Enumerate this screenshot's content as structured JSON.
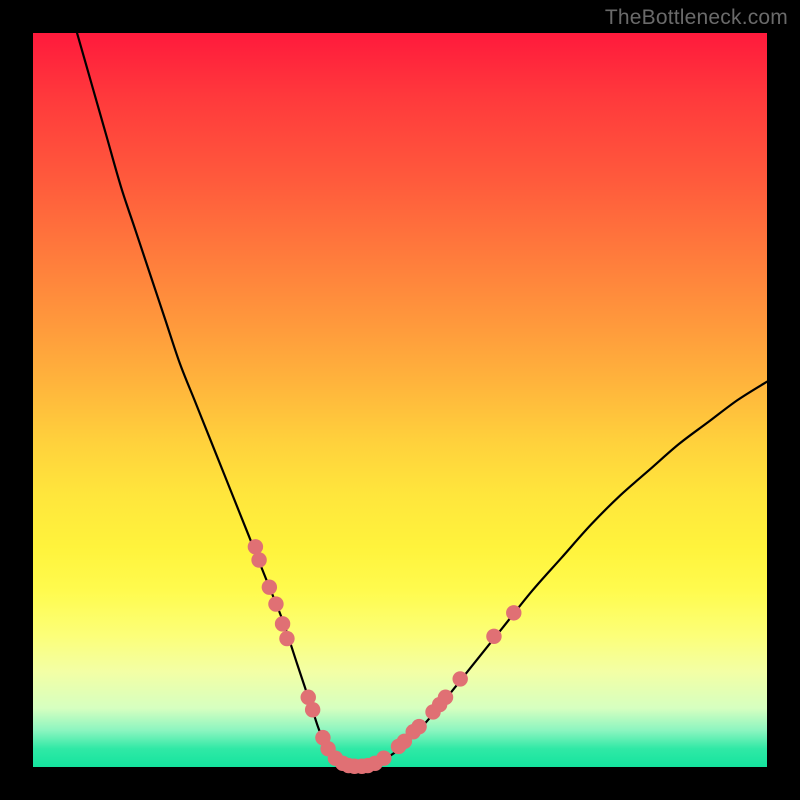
{
  "watermark": "TheBottleneck.com",
  "chart_data": {
    "type": "line",
    "title": "",
    "xlabel": "",
    "ylabel": "",
    "xlim": [
      0,
      100
    ],
    "ylim": [
      0,
      100
    ],
    "grid": false,
    "series": [
      {
        "name": "curve",
        "color": "#000000",
        "x": [
          6,
          8,
          10,
          12,
          14,
          16,
          18,
          20,
          22,
          24,
          26,
          28,
          30,
          32,
          34,
          36,
          37,
          38,
          39,
          40,
          41,
          42,
          43,
          45,
          47,
          50,
          53,
          56,
          60,
          64,
          68,
          72,
          76,
          80,
          84,
          88,
          92,
          96,
          100
        ],
        "y": [
          100,
          93,
          86,
          79,
          73,
          67,
          61,
          55,
          50,
          45,
          40,
          35,
          30,
          25,
          20,
          14,
          11,
          8,
          5,
          3,
          1.5,
          0.6,
          0,
          0,
          0.6,
          2.5,
          5.5,
          9,
          14,
          19,
          24,
          28.5,
          33,
          37,
          40.5,
          44,
          47,
          50,
          52.5
        ]
      }
    ],
    "markers": [
      {
        "x": 30.3,
        "y": 30,
        "r": 1.05
      },
      {
        "x": 30.8,
        "y": 28.2,
        "r": 1.05
      },
      {
        "x": 32.2,
        "y": 24.5,
        "r": 1.05
      },
      {
        "x": 33.1,
        "y": 22.2,
        "r": 1.05
      },
      {
        "x": 34.0,
        "y": 19.5,
        "r": 1.05
      },
      {
        "x": 34.6,
        "y": 17.5,
        "r": 1.05
      },
      {
        "x": 37.5,
        "y": 9.5,
        "r": 1.05
      },
      {
        "x": 38.1,
        "y": 7.8,
        "r": 1.05
      },
      {
        "x": 39.5,
        "y": 4.0,
        "r": 1.05
      },
      {
        "x": 40.2,
        "y": 2.5,
        "r": 1.05
      },
      {
        "x": 41.2,
        "y": 1.2,
        "r": 1.05
      },
      {
        "x": 42.2,
        "y": 0.5,
        "r": 1.05
      },
      {
        "x": 43.0,
        "y": 0.2,
        "r": 1.05
      },
      {
        "x": 43.8,
        "y": 0.1,
        "r": 1.05
      },
      {
        "x": 44.8,
        "y": 0.1,
        "r": 1.05
      },
      {
        "x": 45.6,
        "y": 0.2,
        "r": 1.05
      },
      {
        "x": 46.6,
        "y": 0.5,
        "r": 1.05
      },
      {
        "x": 47.8,
        "y": 1.2,
        "r": 1.05
      },
      {
        "x": 49.8,
        "y": 2.8,
        "r": 1.05
      },
      {
        "x": 50.6,
        "y": 3.5,
        "r": 1.05
      },
      {
        "x": 51.8,
        "y": 4.8,
        "r": 1.05
      },
      {
        "x": 52.6,
        "y": 5.5,
        "r": 1.05
      },
      {
        "x": 54.5,
        "y": 7.5,
        "r": 1.05
      },
      {
        "x": 55.4,
        "y": 8.5,
        "r": 1.05
      },
      {
        "x": 56.2,
        "y": 9.5,
        "r": 1.05
      },
      {
        "x": 58.2,
        "y": 12.0,
        "r": 1.05
      },
      {
        "x": 62.8,
        "y": 17.8,
        "r": 1.05
      },
      {
        "x": 65.5,
        "y": 21.0,
        "r": 1.05
      }
    ],
    "marker_style": {
      "fill": "#e07074",
      "stroke": "none"
    },
    "background_gradient": {
      "top": "#ff1a3c",
      "mid": "#fff33c",
      "bottom": "#14e49e"
    }
  }
}
